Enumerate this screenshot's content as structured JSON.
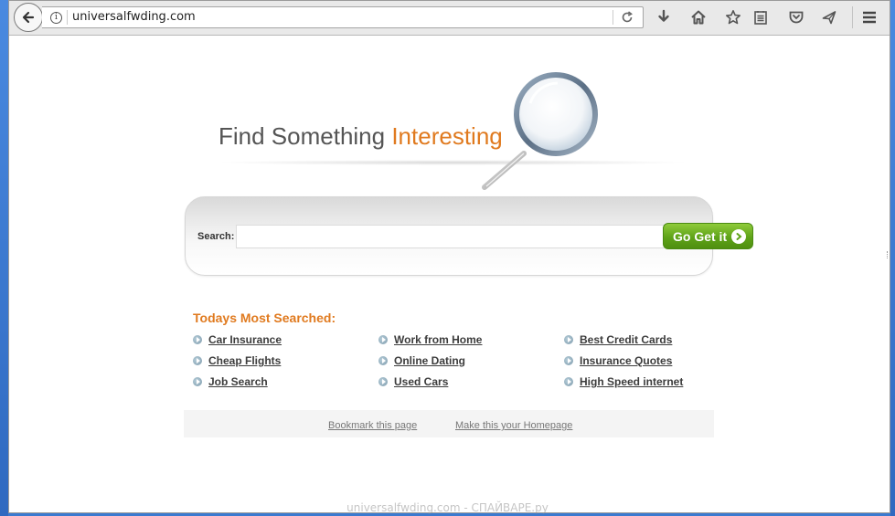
{
  "browser": {
    "url": "universalfwding.com"
  },
  "hero": {
    "title_plain": "Find Something ",
    "title_accent": "Interesting"
  },
  "search": {
    "label": "Search:",
    "value": "",
    "button_label": "Go Get it"
  },
  "most_searched": {
    "title": "Todays Most Searched:",
    "links": [
      "Car Insurance",
      "Work from Home",
      "Best Credit Cards",
      "Cheap Flights",
      "Online Dating",
      "Insurance Quotes",
      "Job Search",
      "Used Cars",
      "High Speed internet"
    ]
  },
  "footer": {
    "bookmark": "Bookmark this page",
    "homepage": "Make this your Homepage"
  },
  "watermark": "universalfwding.com - СПАЙВАРЕ.ру",
  "colors": {
    "accent": "#e07a1f",
    "button_green": "#5fa319",
    "desktop_blue": "#3b7ad0"
  },
  "icons": [
    "back-arrow-icon",
    "info-icon",
    "reload-icon",
    "download-icon",
    "home-icon",
    "star-icon",
    "reading-list-icon",
    "pocket-icon",
    "send-icon",
    "hamburger-menu-icon",
    "magnifier-graphic",
    "bullet-arrow-icon",
    "go-arrow-icon"
  ]
}
